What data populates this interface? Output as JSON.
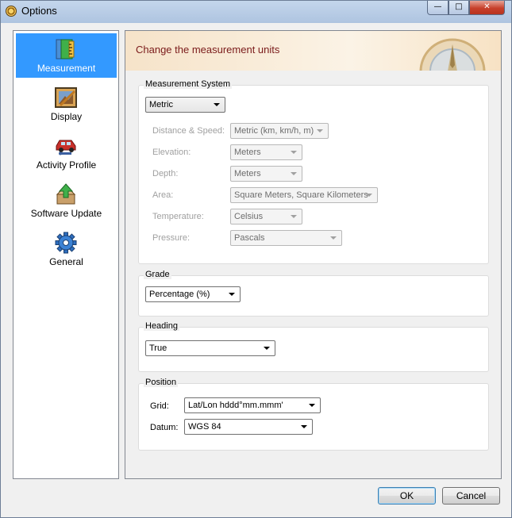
{
  "window": {
    "title": "Options"
  },
  "sidebar": {
    "items": [
      {
        "label": "Measurement",
        "icon": "measurement-icon",
        "selected": true
      },
      {
        "label": "Display",
        "icon": "display-icon",
        "selected": false
      },
      {
        "label": "Activity Profile",
        "icon": "car-icon",
        "selected": false
      },
      {
        "label": "Software Update",
        "icon": "software-update-icon",
        "selected": false
      },
      {
        "label": "General",
        "icon": "gear-icon",
        "selected": false
      }
    ]
  },
  "banner": {
    "title": "Change the measurement units"
  },
  "measurement_system": {
    "title": "Measurement System",
    "system_value": "Metric",
    "rows": [
      {
        "label": "Distance & Speed:",
        "value": "Metric (km, km/h, m)"
      },
      {
        "label": "Elevation:",
        "value": "Meters"
      },
      {
        "label": "Depth:",
        "value": "Meters"
      },
      {
        "label": "Area:",
        "value": "Square Meters, Square Kilometers"
      },
      {
        "label": "Temperature:",
        "value": "Celsius"
      },
      {
        "label": "Pressure:",
        "value": "Pascals"
      }
    ]
  },
  "grade": {
    "title": "Grade",
    "value": "Percentage (%)"
  },
  "heading": {
    "title": "Heading",
    "value": "True"
  },
  "position": {
    "title": "Position",
    "grid_label": "Grid:",
    "grid_value": "Lat/Lon hddd°mm.mmm'",
    "datum_label": "Datum:",
    "datum_value": "WGS 84"
  },
  "buttons": {
    "ok": "OK",
    "cancel": "Cancel"
  },
  "colors": {
    "selection": "#3399ff",
    "banner_title": "#7a1a1a"
  }
}
